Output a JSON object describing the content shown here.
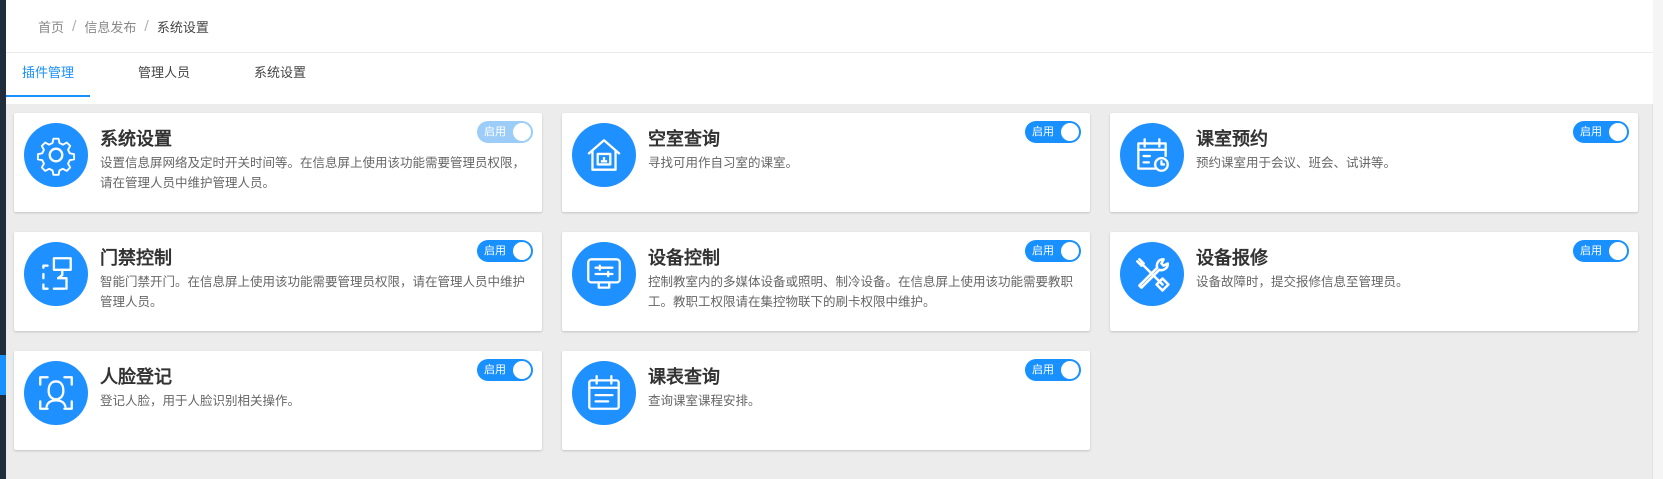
{
  "breadcrumb": {
    "home": "首页",
    "section": "信息发布",
    "current": "系统设置",
    "separator": "/"
  },
  "tabs": [
    {
      "label": "插件管理",
      "active": true
    },
    {
      "label": "管理人员",
      "active": false
    },
    {
      "label": "系统设置",
      "active": false
    }
  ],
  "colors": {
    "accent": "#1890ff",
    "icon_bg": "#1e90ff",
    "toggle_faded": "#9ccdf8"
  },
  "plugins": [
    {
      "title": "系统设置",
      "desc": "设置信息屏网络及定时开关时间等。在信息屏上使用该功能需要管理员权限，请在管理人员中维护管理人员。",
      "toggle": "启用",
      "icon": "gear-icon"
    },
    {
      "title": "空室查询",
      "desc": "寻找可用作自习室的课室。",
      "toggle": "启用",
      "icon": "room-house-icon"
    },
    {
      "title": "课室预约",
      "desc": "预约课室用于会议、班会、试讲等。",
      "toggle": "启用",
      "icon": "calendar-clock-icon"
    },
    {
      "title": "门禁控制",
      "desc": "智能门禁开门。在信息屏上使用该功能需要管理员权限，请在管理人员中维护管理人员。",
      "toggle": "启用",
      "icon": "door-access-icon"
    },
    {
      "title": "设备控制",
      "desc": "控制教室内的多媒体设备或照明、制冷设备。在信息屏上使用该功能需要教职工。教职工权限请在集控物联下的刷卡权限中维护。",
      "toggle": "启用",
      "icon": "monitor-control-icon"
    },
    {
      "title": "设备报修",
      "desc": "设备故障时，提交报修信息至管理员。",
      "toggle": "启用",
      "icon": "repair-tools-icon"
    },
    {
      "title": "人脸登记",
      "desc": "登记人脸，用于人脸识别相关操作。",
      "toggle": "启用",
      "icon": "face-scan-icon"
    },
    {
      "title": "课表查询",
      "desc": "查询课室课程安排。",
      "toggle": "启用",
      "icon": "timetable-icon"
    }
  ]
}
